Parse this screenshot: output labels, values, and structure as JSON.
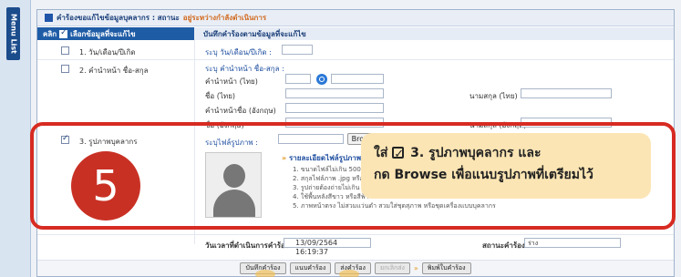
{
  "sidebar": {
    "menu_label": "Menu List"
  },
  "panel": {
    "title": "คำร้องขอแก้ไขข้อมูลบุคลากร : สถานะ",
    "status": "อยู่ระหว่างกำลังดำเนินการ"
  },
  "table_header": {
    "select_col": "เลือกข้อมูลที่จะแก้ไข",
    "record_col": "บันทึกคำร้องตามข้อมูลที่จะแก้ไข",
    "check_label": "คลิก"
  },
  "rows": {
    "row1": {
      "label": "1. วัน/เดือน/ปีเกิด",
      "field": "ระบุ วัน/เดือน/ปีเกิด :"
    },
    "row2": {
      "label": "2. คำนำหน้า ชื่อ-สกุล",
      "field": "ระบุ คำนำหน้า ชื่อ-สกุล :",
      "prefix_th": "คำนำหน้า (ไทย)",
      "name_th": "ชื่อ (ไทย)",
      "surname_th": "นามสกุล (ไทย)",
      "prefix_en": "คำนำหน้าชื่อ (อังกฤษ)",
      "name_en": "ชื่อ (อังกฤษ)",
      "surname_en": "นามสกุล (อังกฤษ)"
    },
    "row3": {
      "label": "3. รูปภาพบุคลากร",
      "field": "ระบุไฟล์รูปภาพ :",
      "browse": "Browse...",
      "hint_title": "รายละเอียดไฟล์รูปภาพ",
      "hints": [
        "1. ขนาดไฟล์ไม่เกิน 500 KB",
        "2. สกุลไฟล์ภาพ .jpg หรือ .png",
        "3. รูปถ่ายต้องถ่ายไม่เกิน 6 เดือน",
        "4. ใช้พื้นหลังสีขาว หรือสีฟ้า",
        "5. ภาพหน้าตรง ไม่สวมแว่นดำ สวมใส่ชุดสุภาพ หรือชุดเครื่องแบบบุคลากร"
      ]
    }
  },
  "footer_info": {
    "datetime_label": "วันเวลาที่ดำเนินการคำร้อง",
    "datetime_value": "13/09/2564 16:19:37",
    "status_label": "สถานะคำร้อง",
    "status_value": "ร่าง"
  },
  "buttons": {
    "save": "บันทึกคำร้อง",
    "edit": "แนบคำร้อง",
    "send": "ส่งคำร้อง",
    "cancel": "ยกเลิกส่ง",
    "print": "พิมพ์ใบคำร้อง"
  },
  "callout": {
    "line1_prefix": "ใส่",
    "line1_rest": "3. รูปภาพบุคลากร และ",
    "line2": "กด Browse เพื่อแนบรูปภาพที่เตรียมไว้"
  },
  "step": {
    "number": "5"
  },
  "colors": {
    "accent": "#1f5ca6",
    "highlight": "#d72b22",
    "callout_bg": "#fbe5b4",
    "step_bg": "#c93024"
  }
}
